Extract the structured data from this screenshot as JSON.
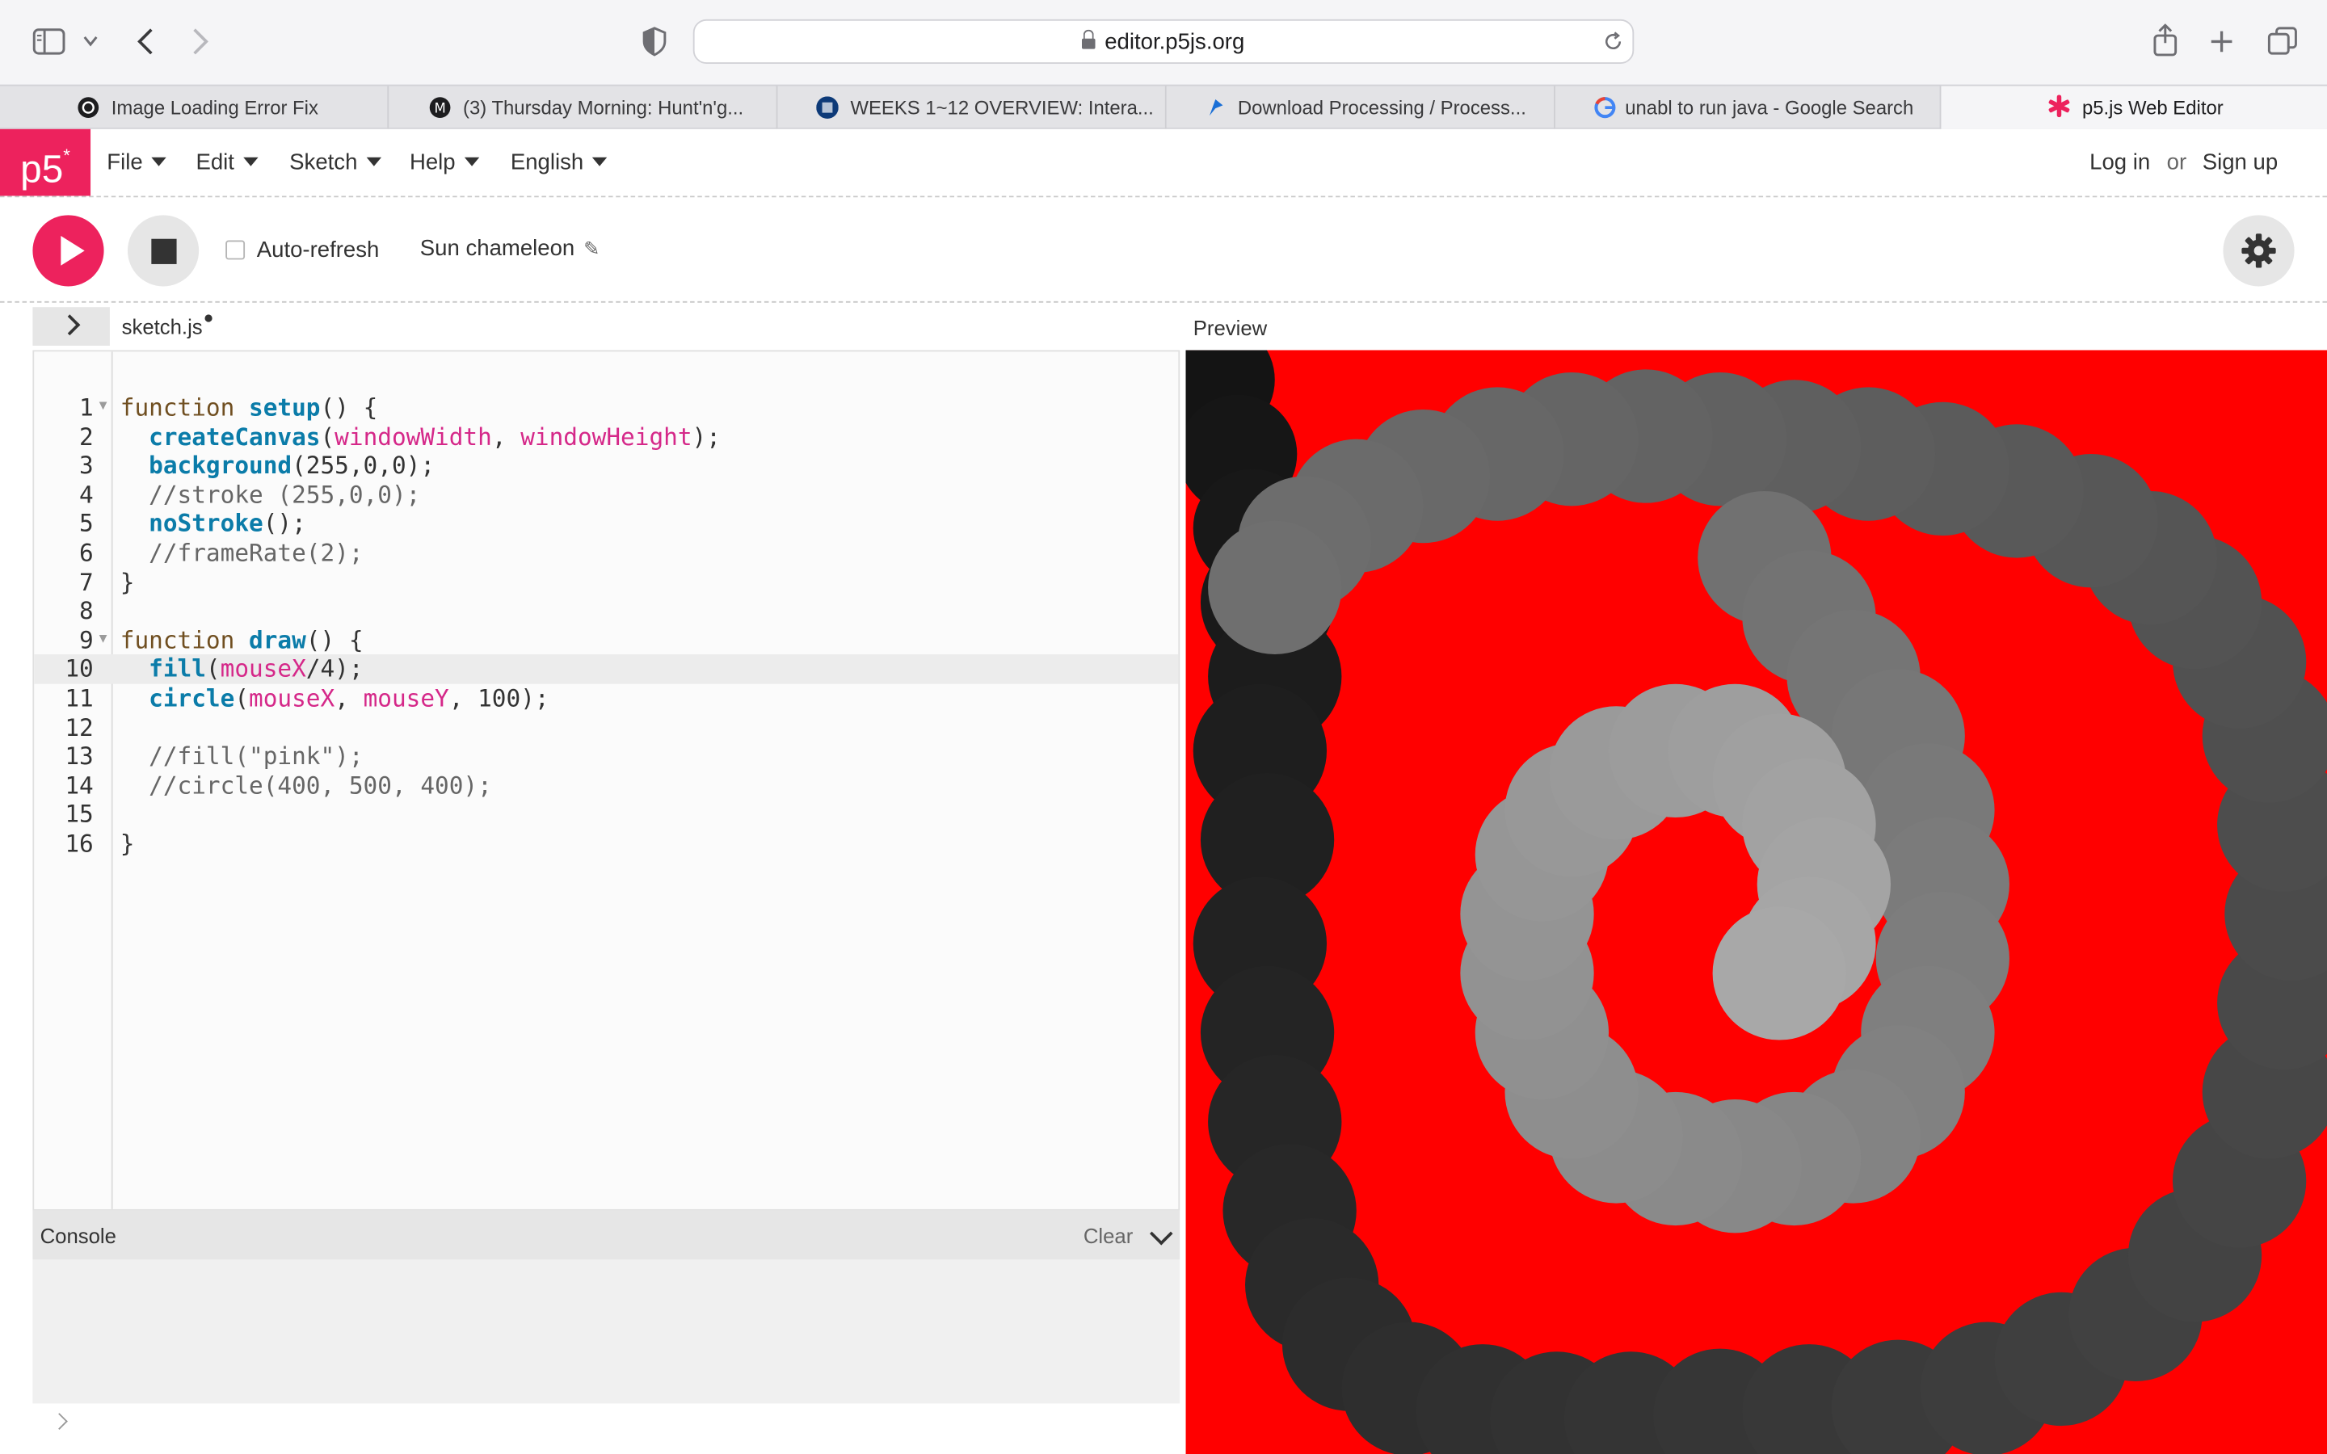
{
  "browser": {
    "url": "editor.p5js.org",
    "tabs": [
      {
        "label": "Image Loading Error Fix",
        "icon": "chatgpt-icon",
        "active": false
      },
      {
        "label": "(3) Thursday Morning: Hunt'n'g...",
        "icon": "site-icon",
        "active": false
      },
      {
        "label": "WEEKS 1~12 OVERVIEW: Intera...",
        "icon": "site-icon",
        "active": false
      },
      {
        "label": "Download Processing / Process...",
        "icon": "processing-icon",
        "active": false
      },
      {
        "label": "unabl to run java - Google Search",
        "icon": "google-icon",
        "active": false
      },
      {
        "label": "p5.js Web Editor",
        "icon": "p5-asterisk-icon",
        "active": true
      }
    ]
  },
  "app": {
    "logo": "p5",
    "logo_sup": "*",
    "menu": [
      "File",
      "Edit",
      "Sketch",
      "Help",
      "English"
    ],
    "auth": {
      "login": "Log in",
      "or": "or",
      "signup": "Sign up"
    }
  },
  "toolbar": {
    "auto_refresh_label": "Auto-refresh",
    "auto_refresh_checked": false,
    "sketch_name": "Sun chameleon"
  },
  "editor": {
    "file_name": "sketch.js",
    "unsaved": true,
    "preview_label": "Preview",
    "active_line": 10,
    "line_numbers": [
      "1",
      "2",
      "3",
      "4",
      "5",
      "6",
      "7",
      "8",
      "9",
      "10",
      "11",
      "12",
      "13",
      "14",
      "15",
      "16"
    ],
    "code_lines": [
      "function setup() {",
      "  createCanvas(windowWidth, windowHeight);",
      "  background(255,0,0);",
      "  //stroke (255,0,0);",
      "  noStroke();",
      "  //frameRate(2);",
      "}",
      "",
      "function draw() {",
      "  fill(mouseX/4);",
      "  circle(mouseX, mouseY, 100);",
      "",
      "  //fill(\"pink\");",
      "  //circle(400, 500, 400);",
      "",
      "}"
    ]
  },
  "console": {
    "title": "Console",
    "clear_label": "Clear"
  },
  "colors": {
    "accent": "#ed225d",
    "canvas_bg": "#ff0000"
  }
}
